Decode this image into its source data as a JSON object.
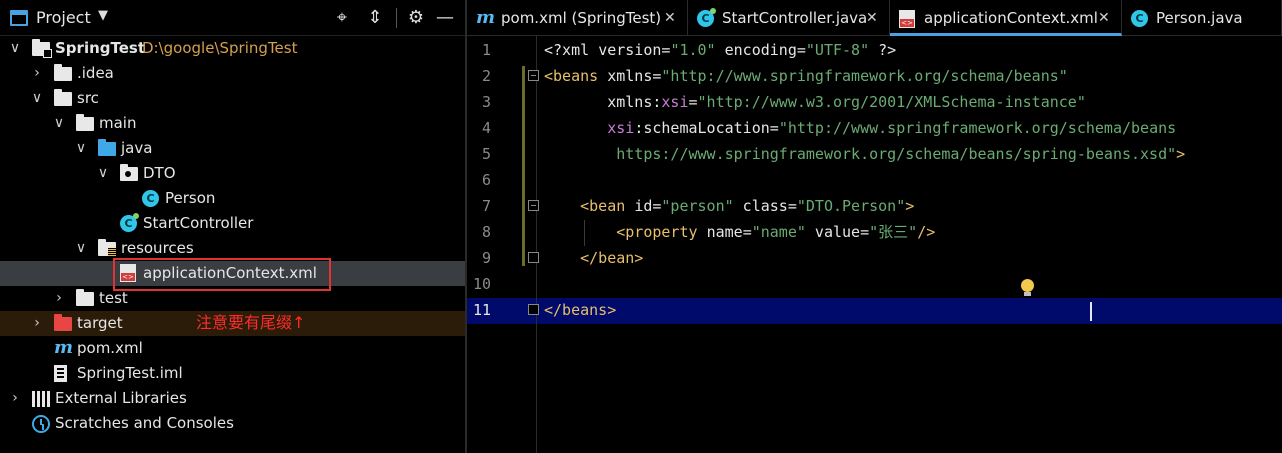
{
  "project_panel": {
    "title": "Project",
    "caret": "▼",
    "tools": {
      "locate": "⌖",
      "collapse": "⇕",
      "settings": "⚙",
      "hide": "—"
    }
  },
  "tree": [
    {
      "label": "SpringTest",
      "path": "D:\\google\\SpringTest",
      "bold": true,
      "arrow": "∨",
      "icon": "module-folder-icon",
      "level": 0
    },
    {
      "label": ".idea",
      "arrow": "›",
      "icon": "folder-icon",
      "level": 1
    },
    {
      "label": "src",
      "arrow": "∨",
      "icon": "folder-icon",
      "level": 1
    },
    {
      "label": "main",
      "arrow": "∨",
      "icon": "folder-icon",
      "level": 2
    },
    {
      "label": "java",
      "arrow": "∨",
      "icon": "source-folder-icon",
      "level": 3
    },
    {
      "label": "DTO",
      "arrow": "∨",
      "icon": "package-icon",
      "level": 4
    },
    {
      "label": "Person",
      "icon": "class-icon",
      "level": 5
    },
    {
      "label": "StartController",
      "icon": "runnable-class-icon",
      "level": 4
    },
    {
      "label": "resources",
      "arrow": "∨",
      "icon": "resources-folder-icon",
      "level": 3
    },
    {
      "label": "applicationContext.xml",
      "icon": "xml-file-icon",
      "level": 4,
      "selected": true
    },
    {
      "label": "test",
      "arrow": "›",
      "icon": "folder-icon",
      "level": 2
    },
    {
      "label": "target",
      "arrow": "›",
      "icon": "excluded-folder-icon",
      "level": 1,
      "excluded": true
    },
    {
      "label": "pom.xml",
      "icon": "maven-file-icon",
      "level": 1
    },
    {
      "label": "SpringTest.iml",
      "icon": "iml-file-icon",
      "level": 1
    },
    {
      "label": "External Libraries",
      "arrow": "›",
      "icon": "libraries-icon",
      "level": 0
    },
    {
      "label": "Scratches and Consoles",
      "icon": "scratches-icon",
      "level": 0
    }
  ],
  "annotation": "注意要有尾缀↑",
  "tabs": [
    {
      "label": "pom.xml (SpringTest)",
      "icon": "maven-file-icon",
      "close": "✕"
    },
    {
      "label": "StartController.java",
      "icon": "runnable-class-icon",
      "close": "✕"
    },
    {
      "label": "applicationContext.xml",
      "icon": "xml-file-icon",
      "close": "✕",
      "active": true
    },
    {
      "label": "Person.java",
      "icon": "class-icon",
      "close": ""
    }
  ],
  "editor": {
    "current_line": 11,
    "lines": [
      {
        "n": "1",
        "tokens": [
          [
            "pi",
            "<?xml "
          ],
          [
            "attr",
            "version"
          ],
          [
            "punct",
            "="
          ],
          [
            "str",
            "\"1.0\""
          ],
          [
            "attr",
            " encoding"
          ],
          [
            "punct",
            "="
          ],
          [
            "str",
            "\"UTF-8\""
          ],
          [
            "pi",
            " ?>"
          ]
        ]
      },
      {
        "n": "2",
        "tokens": [
          [
            "tag",
            "<beans "
          ],
          [
            "attr",
            "xmlns"
          ],
          [
            "punct",
            "="
          ],
          [
            "str",
            "\"http://www.springframework.org/schema/beans\""
          ]
        ]
      },
      {
        "n": "3",
        "tokens": [
          [
            "attr",
            "       xmlns:"
          ],
          [
            "ns",
            "xsi"
          ],
          [
            "punct",
            "="
          ],
          [
            "str",
            "\"http://www.w3.org/2001/XMLSchema-instance\""
          ]
        ]
      },
      {
        "n": "4",
        "tokens": [
          [
            "ns",
            "       xsi"
          ],
          [
            "attr",
            ":schemaLocation"
          ],
          [
            "punct",
            "="
          ],
          [
            "str",
            "\"http://www.springframework.org/schema/beans"
          ]
        ]
      },
      {
        "n": "5",
        "tokens": [
          [
            "str",
            "        https://www.springframework.org/schema/beans/spring-beans.xsd\""
          ],
          [
            "tag",
            ">"
          ]
        ]
      },
      {
        "n": "6",
        "tokens": []
      },
      {
        "n": "7",
        "tokens": [
          [
            "tag",
            "    <bean "
          ],
          [
            "attr",
            "id"
          ],
          [
            "punct",
            "="
          ],
          [
            "str",
            "\"person\""
          ],
          [
            "attr",
            " class"
          ],
          [
            "punct",
            "="
          ],
          [
            "str",
            "\"DTO.Person\""
          ],
          [
            "tag",
            ">"
          ]
        ]
      },
      {
        "n": "8",
        "tokens": [
          [
            "tag",
            "        <property "
          ],
          [
            "attr",
            "name"
          ],
          [
            "punct",
            "="
          ],
          [
            "str",
            "\"name\""
          ],
          [
            "attr",
            " value"
          ],
          [
            "punct",
            "="
          ],
          [
            "str",
            "\"张三\""
          ],
          [
            "tag",
            "/>"
          ]
        ]
      },
      {
        "n": "9",
        "tokens": [
          [
            "tag",
            "    </bean>"
          ]
        ]
      },
      {
        "n": "10",
        "tokens": []
      },
      {
        "n": "11",
        "tokens": [
          [
            "tag",
            "</beans>"
          ]
        ]
      }
    ]
  },
  "colors": {
    "accent": "#4aa3df",
    "annotation": "#ff2b2b",
    "highlight_box": "#e03333",
    "current_line": "#000a6b"
  }
}
